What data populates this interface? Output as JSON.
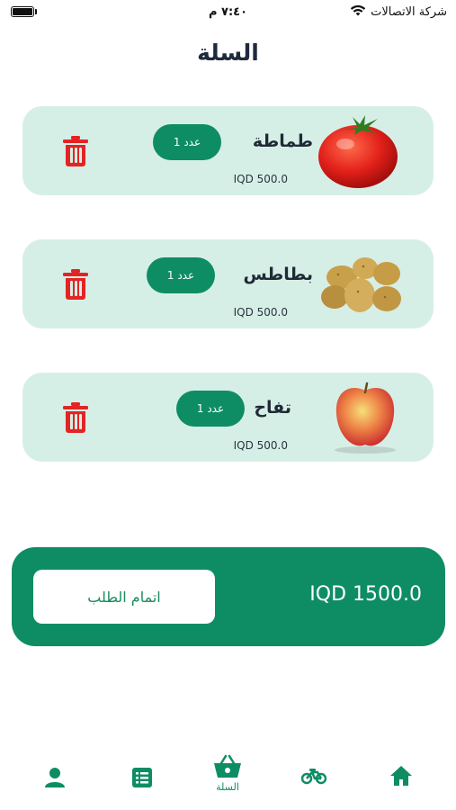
{
  "status_bar": {
    "carrier": "شركة الاتصالات",
    "time": "٧:٤٠ م"
  },
  "page_title": "السلة",
  "cart_items": [
    {
      "name": "طماطة",
      "qty": "عدد 1",
      "price": "IQD 500.0",
      "thumb_icon": "tomato-icon"
    },
    {
      "name": "بطاطس",
      "qty": "عدد 1",
      "price": "IQD 500.0",
      "thumb_icon": "potatoes-icon"
    },
    {
      "name": "تفاح",
      "qty": "عدد 1",
      "price": "IQD 500.0",
      "thumb_icon": "apple-icon"
    }
  ],
  "checkout": {
    "total": "IQD 1500.0",
    "button_label": "اتمام الطلب"
  },
  "bottom_nav": [
    {
      "icon": "home-icon"
    },
    {
      "icon": "delivery-bike-icon"
    },
    {
      "icon": "basket-icon",
      "label": "السلة"
    },
    {
      "icon": "orders-list-icon"
    },
    {
      "icon": "profile-icon"
    }
  ],
  "colors": {
    "primary": "#0e8d64",
    "card_bg": "#d6efe6",
    "delete": "#e32424",
    "title": "#1f2a3d"
  }
}
